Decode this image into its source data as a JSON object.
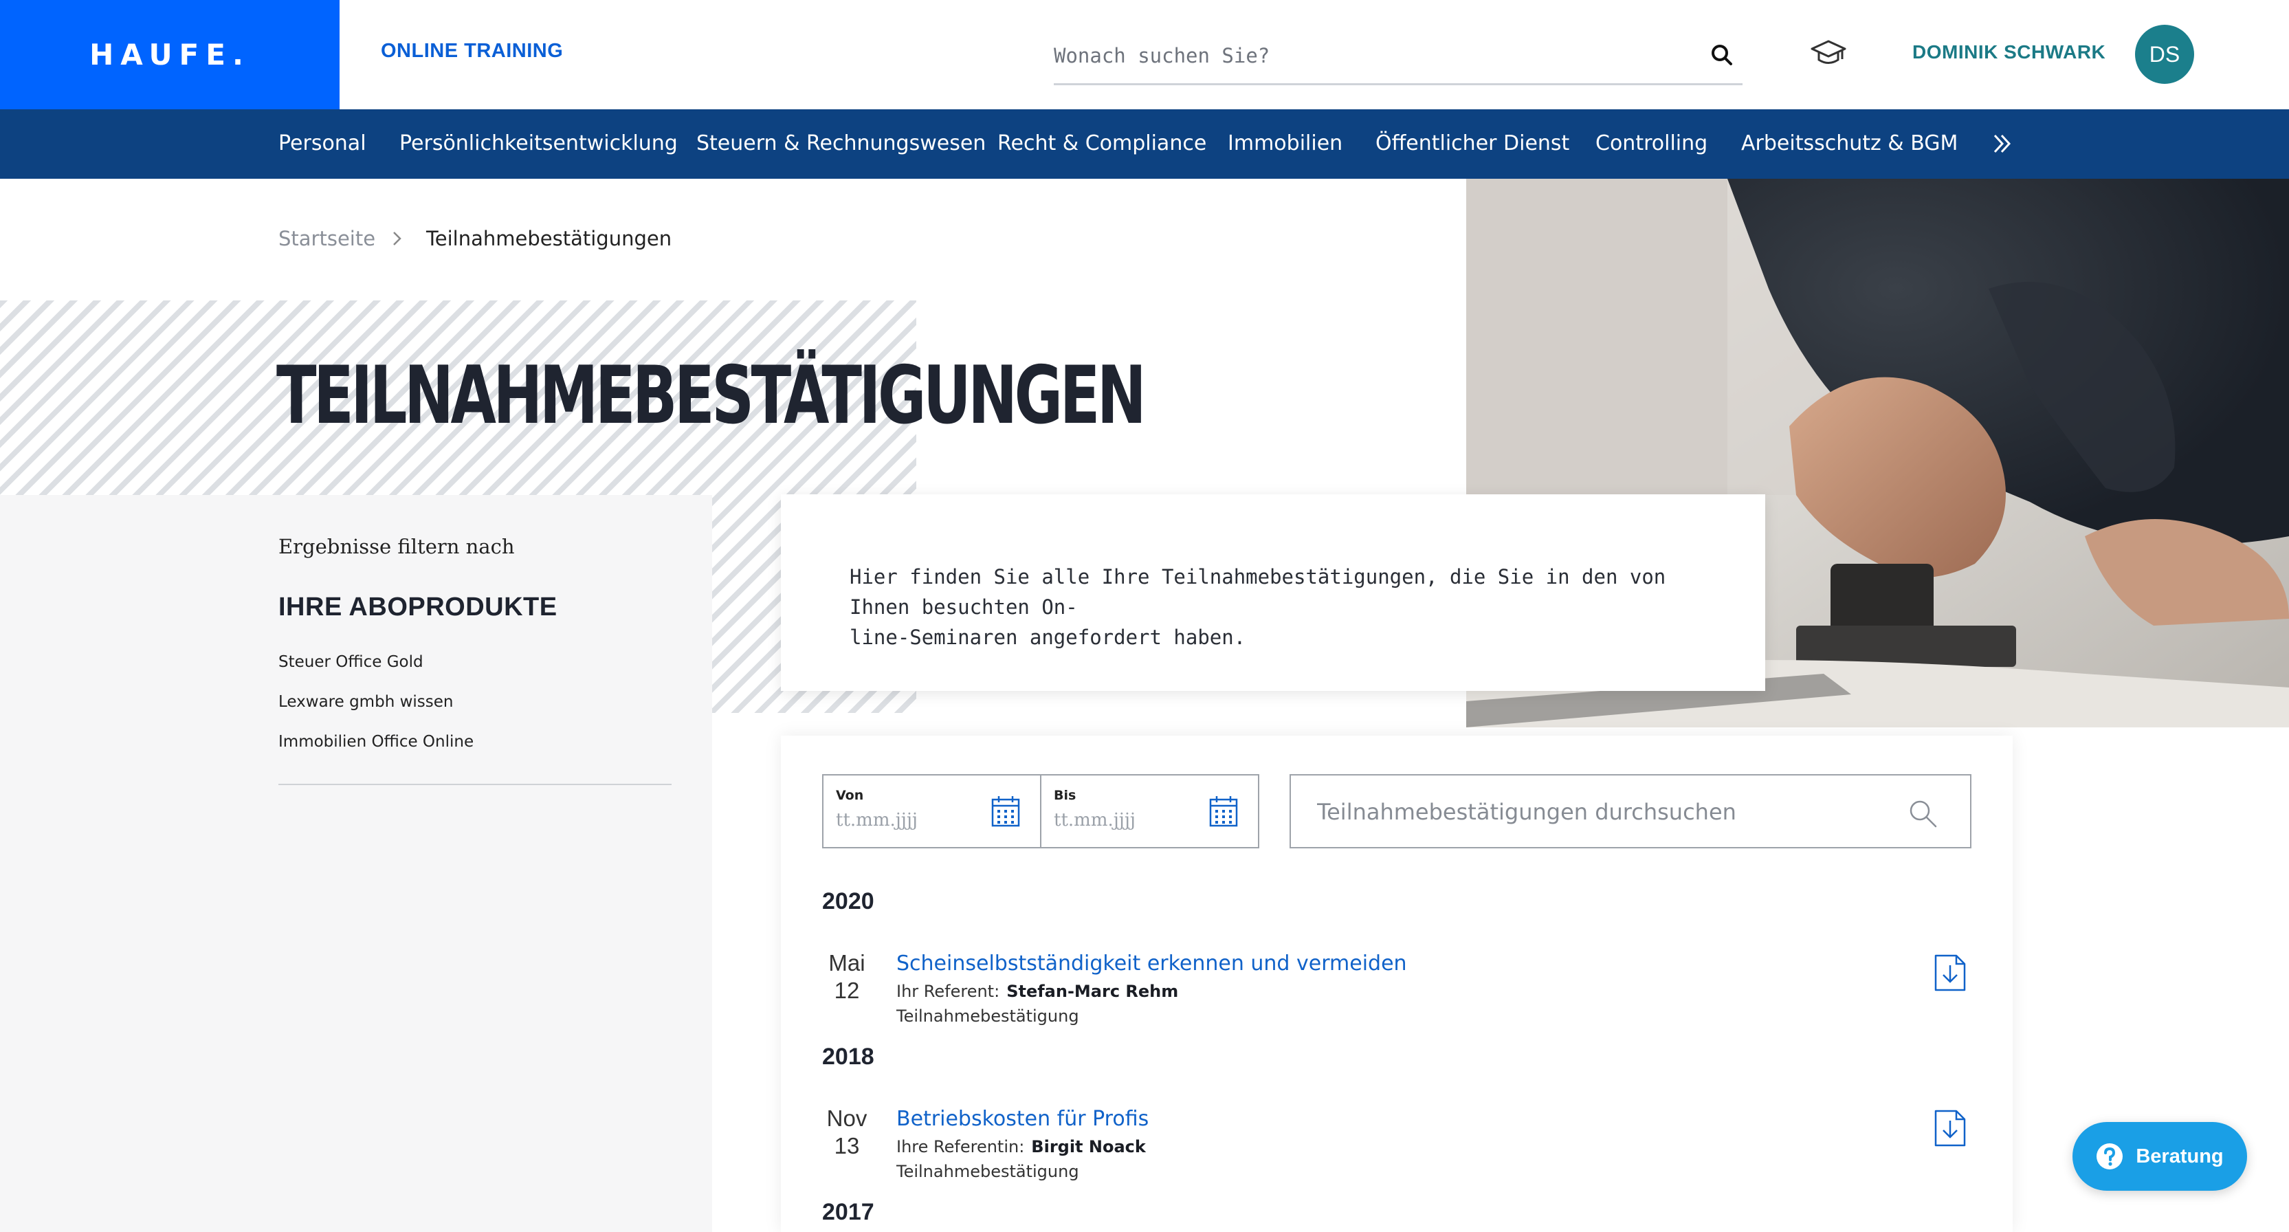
{
  "header": {
    "logo": "HAUFE.",
    "product": "ONLINE TRAINING",
    "search_placeholder": "Wonach suchen Sie?",
    "user_name": "DOMINIK SCHWARK",
    "user_initials": "DS"
  },
  "nav": {
    "items": [
      "Personal",
      "Persönlichkeitsentwicklung",
      "Steuern & Rechnungswesen",
      "Recht & Compliance",
      "Immobilien",
      "Öffentlicher Dienst",
      "Controlling",
      "Arbeitsschutz & BGM"
    ]
  },
  "breadcrumb": {
    "home": "Startseite",
    "current": "Teilnahmebestätigungen"
  },
  "page": {
    "title": "TEILNAHMEBESTÄTIGUNGEN",
    "intro_line1": "Hier finden Sie alle Ihre Teilnahmebestätigungen, die Sie in den von Ihnen besuchten On-",
    "intro_line2": "line-Seminaren angefordert haben."
  },
  "sidebar": {
    "filter_heading": "Ergebnisse filtern nach",
    "abo_heading": "IHRE ABOPRODUKTE",
    "abo_items": [
      "Steuer Office Gold",
      "Lexware gmbh wissen",
      "Immobilien Office Online"
    ]
  },
  "filters": {
    "from_label": "Von",
    "from_placeholder": "tt.mm.jjjj",
    "to_label": "Bis",
    "to_placeholder": "tt.mm.jjjj",
    "search_placeholder": "Teilnahmebestätigungen durchsuchen"
  },
  "results": [
    {
      "year": "2020",
      "entries": [
        {
          "month": "Mai",
          "day": "12",
          "title": "Scheinselbstständigkeit erkennen und vermeiden",
          "ref_label": "Ihr Referent:",
          "ref_name": "Stefan-Marc Rehm",
          "type": "Teilnahmebestätigung"
        }
      ]
    },
    {
      "year": "2018",
      "entries": [
        {
          "month": "Nov",
          "day": "13",
          "title": "Betriebskosten für Profis",
          "ref_label": "Ihre Referentin:",
          "ref_name": "Birgit Noack",
          "type": "Teilnahmebestätigung"
        }
      ]
    },
    {
      "year": "2017",
      "entries": []
    }
  ],
  "beratung": {
    "label": "Beratung"
  },
  "colors": {
    "brand_blue": "#0064ff",
    "nav_blue": "#0d4281",
    "link_blue": "#1062c9",
    "teal": "#1b7f8c",
    "beratung": "#1a9fe6"
  }
}
